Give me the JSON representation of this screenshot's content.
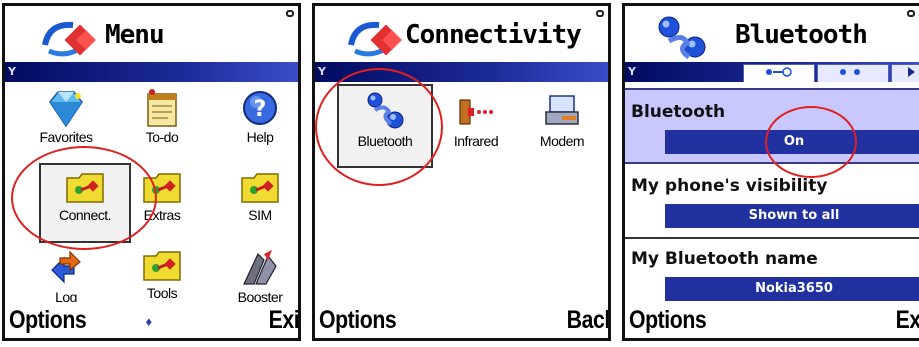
{
  "screens": [
    {
      "title": "Menu",
      "items": [
        {
          "label": "Favorites",
          "icon": "gem-icon"
        },
        {
          "label": "To-do",
          "icon": "notepad-icon"
        },
        {
          "label": "Help",
          "icon": "help-icon"
        },
        {
          "label": "Connect.",
          "icon": "folder-icon"
        },
        {
          "label": "Extras",
          "icon": "folder-icon"
        },
        {
          "label": "SIM",
          "icon": "folder-icon"
        },
        {
          "label": "Log",
          "icon": "log-icon"
        },
        {
          "label": "Tools",
          "icon": "folder-icon"
        },
        {
          "label": "Booster",
          "icon": "booster-icon"
        }
      ],
      "softkeys": {
        "left": "Options",
        "middle": "♦",
        "right": "Exit"
      }
    },
    {
      "title": "Connectivity",
      "items": [
        {
          "label": "Bluetooth",
          "icon": "bluetooth-icon"
        },
        {
          "label": "Infrared",
          "icon": "infrared-icon"
        },
        {
          "label": "Modem",
          "icon": "modem-icon"
        }
      ],
      "softkeys": {
        "left": "Options",
        "right": "Back"
      }
    },
    {
      "title": "Bluetooth",
      "settings": [
        {
          "label": "Bluetooth",
          "value": "On"
        },
        {
          "label": "My phone's visibility",
          "value": "Shown to all"
        },
        {
          "label": "My Bluetooth name",
          "value": "Nokia3650"
        }
      ],
      "softkeys": {
        "left": "Options",
        "right": "Exit"
      }
    }
  ],
  "colors": {
    "titlebar_gradient": "#1c2a98",
    "annotation": "#e02020",
    "selected_setting": "#c8c8ff",
    "value_bar": "#2132a0"
  }
}
